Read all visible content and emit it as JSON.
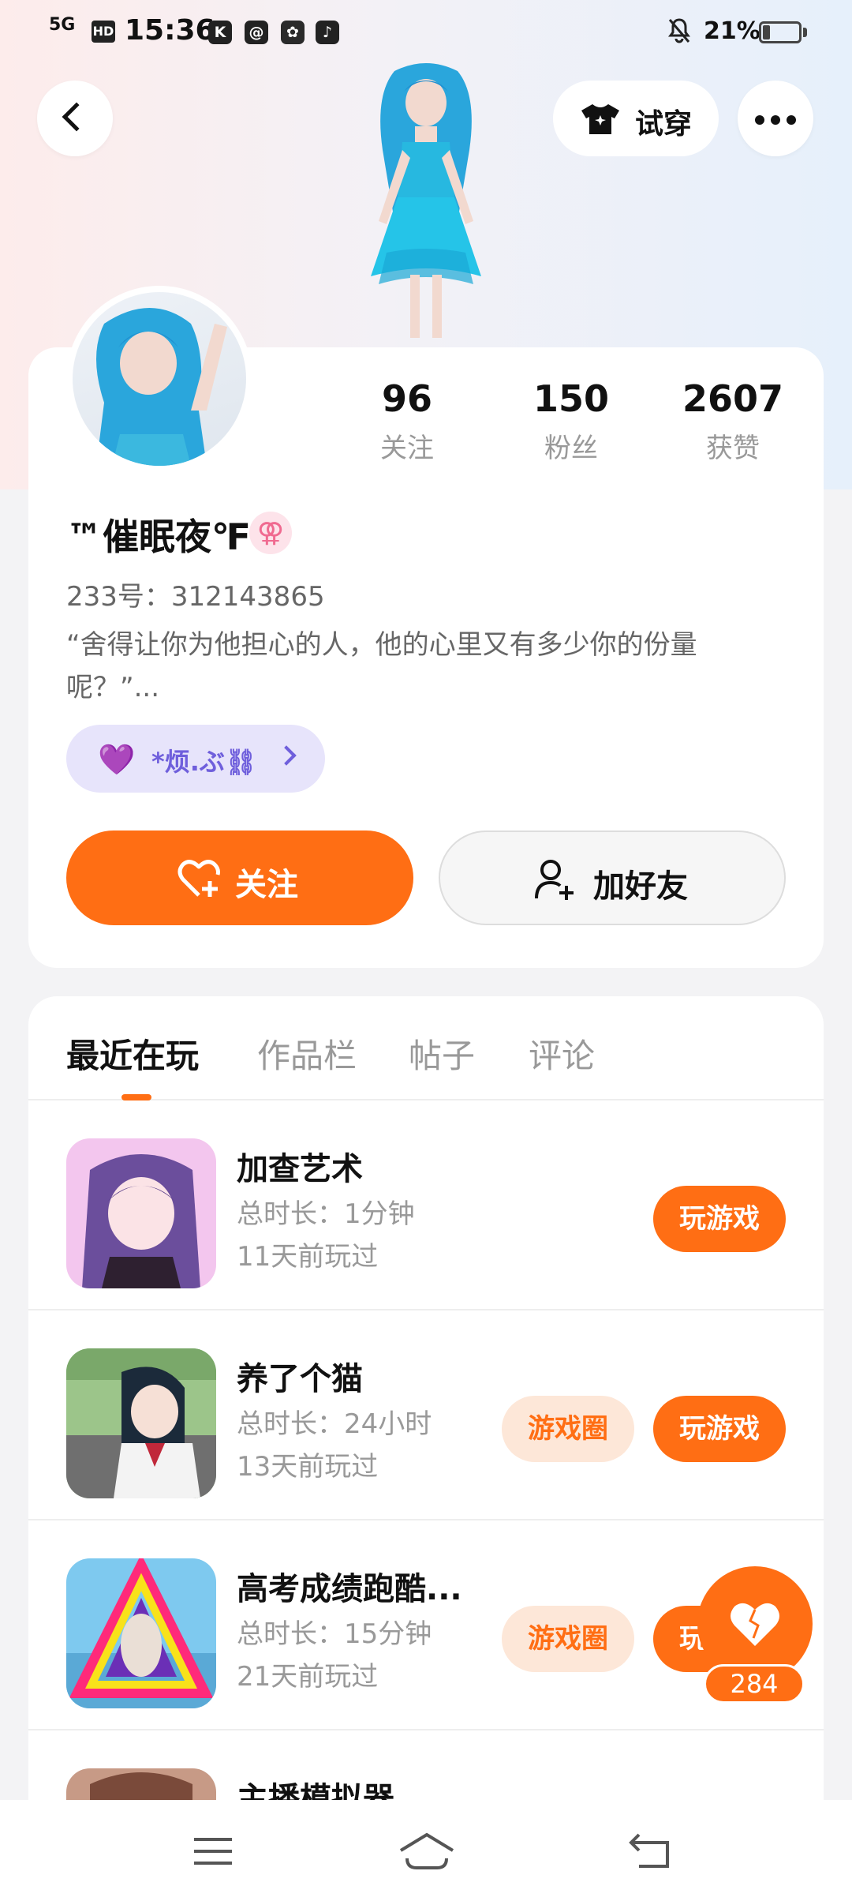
{
  "status_bar": {
    "network": "5G",
    "hd": "HD",
    "time": "15:36",
    "app_icons": [
      "K",
      "@",
      "✿",
      "♪"
    ],
    "battery_percent": "21%",
    "battery_level": 0.21
  },
  "header": {
    "try_on_label": "试穿"
  },
  "profile": {
    "stats": [
      {
        "value": "96",
        "label": "关注"
      },
      {
        "value": "150",
        "label": "粉丝"
      },
      {
        "value": "2607",
        "label": "获赞"
      }
    ],
    "username": "™催眠夜℉",
    "gender_symbol": "⚢",
    "uid": "233号：312143865",
    "bio": "“舍得让你为他担心的人，他的心里又有多少你的份量呢？”...",
    "tag_heart": "💜",
    "tag_text": "*烦.ぶ⛓",
    "follow_label": "关注",
    "add_friend_label": "加好友"
  },
  "tabs": [
    "最近在玩",
    "作品栏",
    "帖子",
    "评论"
  ],
  "games": [
    {
      "title": "加查艺术",
      "duration": "总时长：1分钟",
      "last_played": "11天前玩过",
      "play_label": "玩游戏",
      "circle_label": ""
    },
    {
      "title": "养了个猫",
      "duration": "总时长：24小时",
      "last_played": "13天前玩过",
      "play_label": "玩游戏",
      "circle_label": "游戏圈"
    },
    {
      "title": "高考成绩跑酷...",
      "duration": "总时长：15分钟",
      "last_played": "21天前玩过",
      "play_label": "玩游戏",
      "circle_label": "游戏圈"
    },
    {
      "title": "主播模拟器"
    }
  ],
  "like_count": "284"
}
